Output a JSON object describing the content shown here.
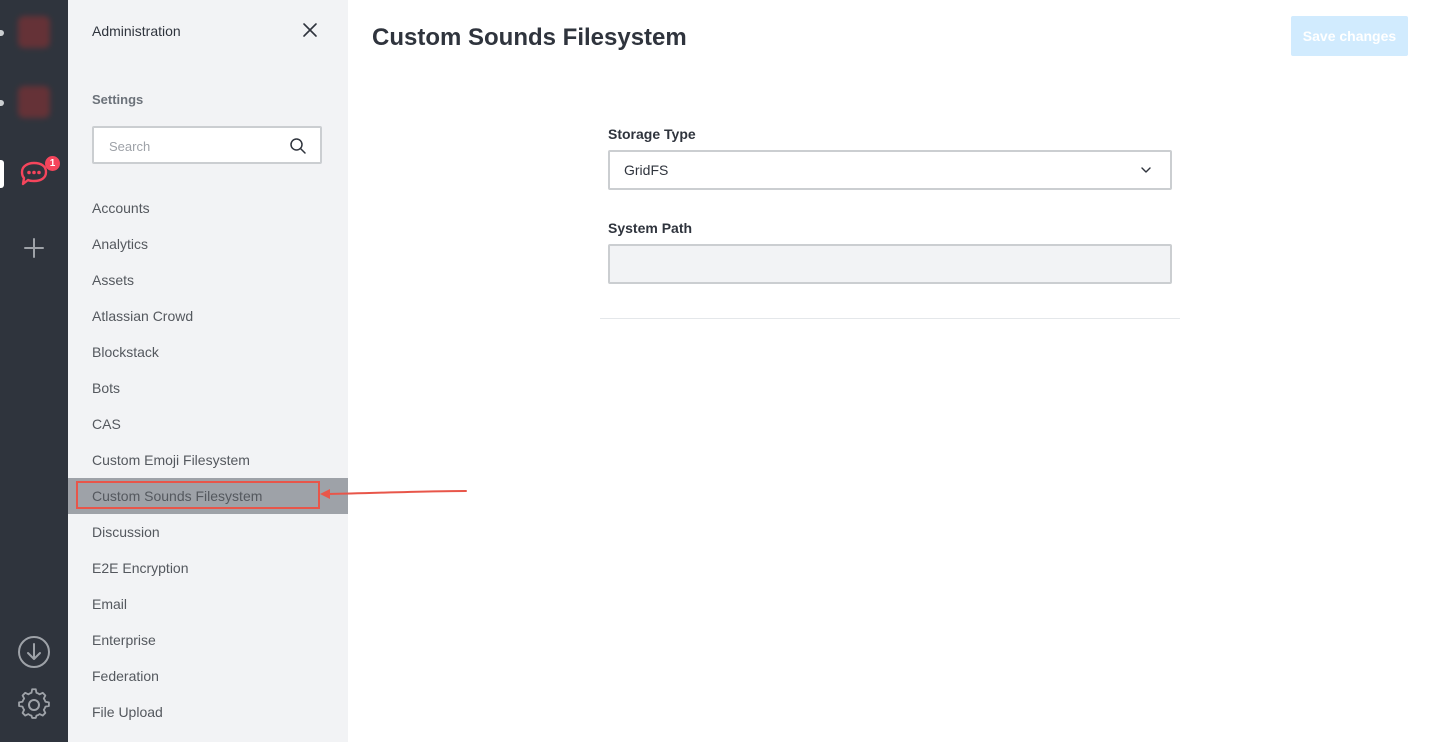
{
  "rail": {
    "badge_count": "1",
    "workspace_color": "#c9302c",
    "icons": [
      "workspace-avatar",
      "workspace-avatar",
      "chat-icon",
      "plus-icon",
      "download-icon",
      "gear-icon"
    ]
  },
  "sidebar": {
    "title": "Administration",
    "section": "Settings",
    "search_placeholder": "Search",
    "items": [
      {
        "label": "Accounts"
      },
      {
        "label": "Analytics"
      },
      {
        "label": "Assets"
      },
      {
        "label": "Atlassian Crowd"
      },
      {
        "label": "Blockstack"
      },
      {
        "label": "Bots"
      },
      {
        "label": "CAS"
      },
      {
        "label": "Custom Emoji Filesystem"
      },
      {
        "label": "Custom Sounds Filesystem",
        "selected": true
      },
      {
        "label": "Discussion"
      },
      {
        "label": "E2E Encryption"
      },
      {
        "label": "Email"
      },
      {
        "label": "Enterprise"
      },
      {
        "label": "Federation"
      },
      {
        "label": "File Upload"
      }
    ]
  },
  "main": {
    "title": "Custom Sounds Filesystem",
    "save_label": "Save changes",
    "storage_type_label": "Storage Type",
    "storage_type_value": "GridFS",
    "system_path_label": "System Path",
    "system_path_value": ""
  },
  "colors": {
    "rail_bg": "#2f343d",
    "sidebar_bg": "#f2f3f5",
    "accent_disabled": "#d1ebfe",
    "highlight_annotation": "#e8564a",
    "badge": "#f5455c"
  }
}
